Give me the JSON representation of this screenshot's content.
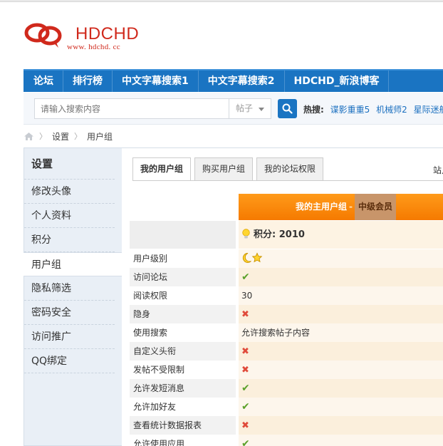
{
  "logo": {
    "title": "HDCHD",
    "subtitle": "www. hdchd. cc"
  },
  "nav": {
    "items": [
      "论坛",
      "排行榜",
      "中文字幕搜索1",
      "中文字幕搜索2",
      "HDCHD_新浪博客"
    ]
  },
  "search": {
    "placeholder": "请输入搜索内容",
    "type_value": "帖子",
    "hot_label": "热搜:",
    "hot_links": [
      "谍影重重5",
      "机械师2",
      "星际迷航"
    ]
  },
  "breadcrumb": {
    "items": [
      "设置",
      "用户组"
    ]
  },
  "sidebar": {
    "title": "设置",
    "items": [
      {
        "label": "修改头像"
      },
      {
        "label": "个人资料"
      },
      {
        "label": "积分"
      },
      {
        "label": "用户组",
        "active": true
      },
      {
        "label": "隐私筛选"
      },
      {
        "label": "密码安全"
      },
      {
        "label": "访问推广"
      },
      {
        "label": "QQ绑定"
      }
    ]
  },
  "tabs": {
    "items": [
      {
        "label": "我的用户组",
        "active": true
      },
      {
        "label": "购买用户组"
      },
      {
        "label": "我的论坛权限"
      }
    ],
    "right_text": "站点"
  },
  "group": {
    "header_label": "我的主用户组",
    "dash": "-",
    "level": "中级会员",
    "score_text": "积分: 2010",
    "rows": [
      {
        "label": "用户级别",
        "value_type": "icons",
        "value": ""
      },
      {
        "label": "访问论坛",
        "value_type": "ok",
        "value": "✔"
      },
      {
        "label": "阅读权限",
        "value_type": "text",
        "value": "30"
      },
      {
        "label": "隐身",
        "value_type": "no",
        "value": "✖"
      },
      {
        "label": "使用搜索",
        "value_type": "text",
        "value": "允许搜索帖子内容"
      },
      {
        "label": "自定义头衔",
        "value_type": "no",
        "value": "✖"
      },
      {
        "label": "发帖不受限制",
        "value_type": "no",
        "value": "✖"
      },
      {
        "label": "允许发短消息",
        "value_type": "ok",
        "value": "✔"
      },
      {
        "label": "允许加好友",
        "value_type": "ok",
        "value": "✔"
      },
      {
        "label": "查看统计数据报表",
        "value_type": "no",
        "value": "✖"
      },
      {
        "label": "允许使用应用",
        "value_type": "ok",
        "value": "✔"
      }
    ]
  },
  "colors": {
    "nav_bg": "#1a74c2",
    "brand_red": "#d0291c",
    "header_orange": "#f57a00",
    "ok_green": "#5ba12a",
    "no_red": "#e04a3a"
  }
}
